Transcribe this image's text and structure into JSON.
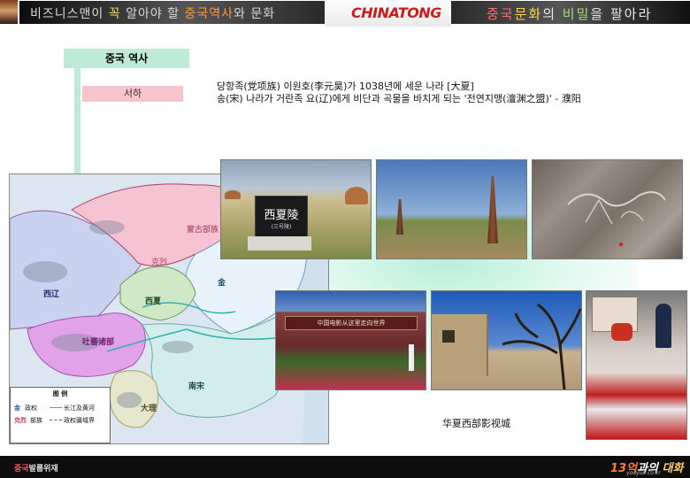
{
  "header": {
    "left_banner_parts": [
      "비즈니스맨이 ",
      "꼭",
      " 알아야 할 ",
      "중국역사",
      "와 문화"
    ],
    "logo": "CHINATONG",
    "right_banner_parts": [
      "중국",
      "문화",
      "의 ",
      "비밀",
      "을 팔아라"
    ]
  },
  "nav": {
    "title": "중국 역사",
    "items": [
      {
        "label": "서하"
      }
    ]
  },
  "description": {
    "line1": "당항족(党项族) 이원호(李元昊)가 1038년에 세운 나라 [大夏]",
    "line2": "송(宋) 나라가 거란족 요(辽)에게 비단과 곡물을 바치게 되는 '전연지맹(澶渊之盟)' - 濮阳"
  },
  "map": {
    "regions": [
      "蒙古部族",
      "克烈",
      "西辽",
      "西夏",
      "金",
      "吐蕃诸部",
      "南宋",
      "大理"
    ],
    "legend": {
      "title": "图 例",
      "items": [
        "金",
        "政权",
        "长江及黄河",
        "克烈",
        "部族",
        "政权疆域界"
      ]
    },
    "colors": {
      "xixia": "#cfe8c6",
      "liao_west": "#c9d2ee",
      "mongol": "#f6c3d3",
      "jin": "#e8f2fa",
      "tibet": "#e2a2e8",
      "song": "#d3ecec",
      "dali": "#e6e6cc"
    }
  },
  "photos": {
    "xixia_tomb": {
      "sign_title": "西夏陵",
      "sign_sub": "(三号陵)"
    },
    "film_city": {
      "banner": "中国电影从这里走向世界"
    }
  },
  "caption": "华夏西部影视城",
  "footer": {
    "left_parts": [
      "중국",
      "발룹위재"
    ],
    "right_parts": [
      "13",
      "억",
      "과의 ",
      "대화"
    ],
    "url": "youyue.co.kr"
  }
}
